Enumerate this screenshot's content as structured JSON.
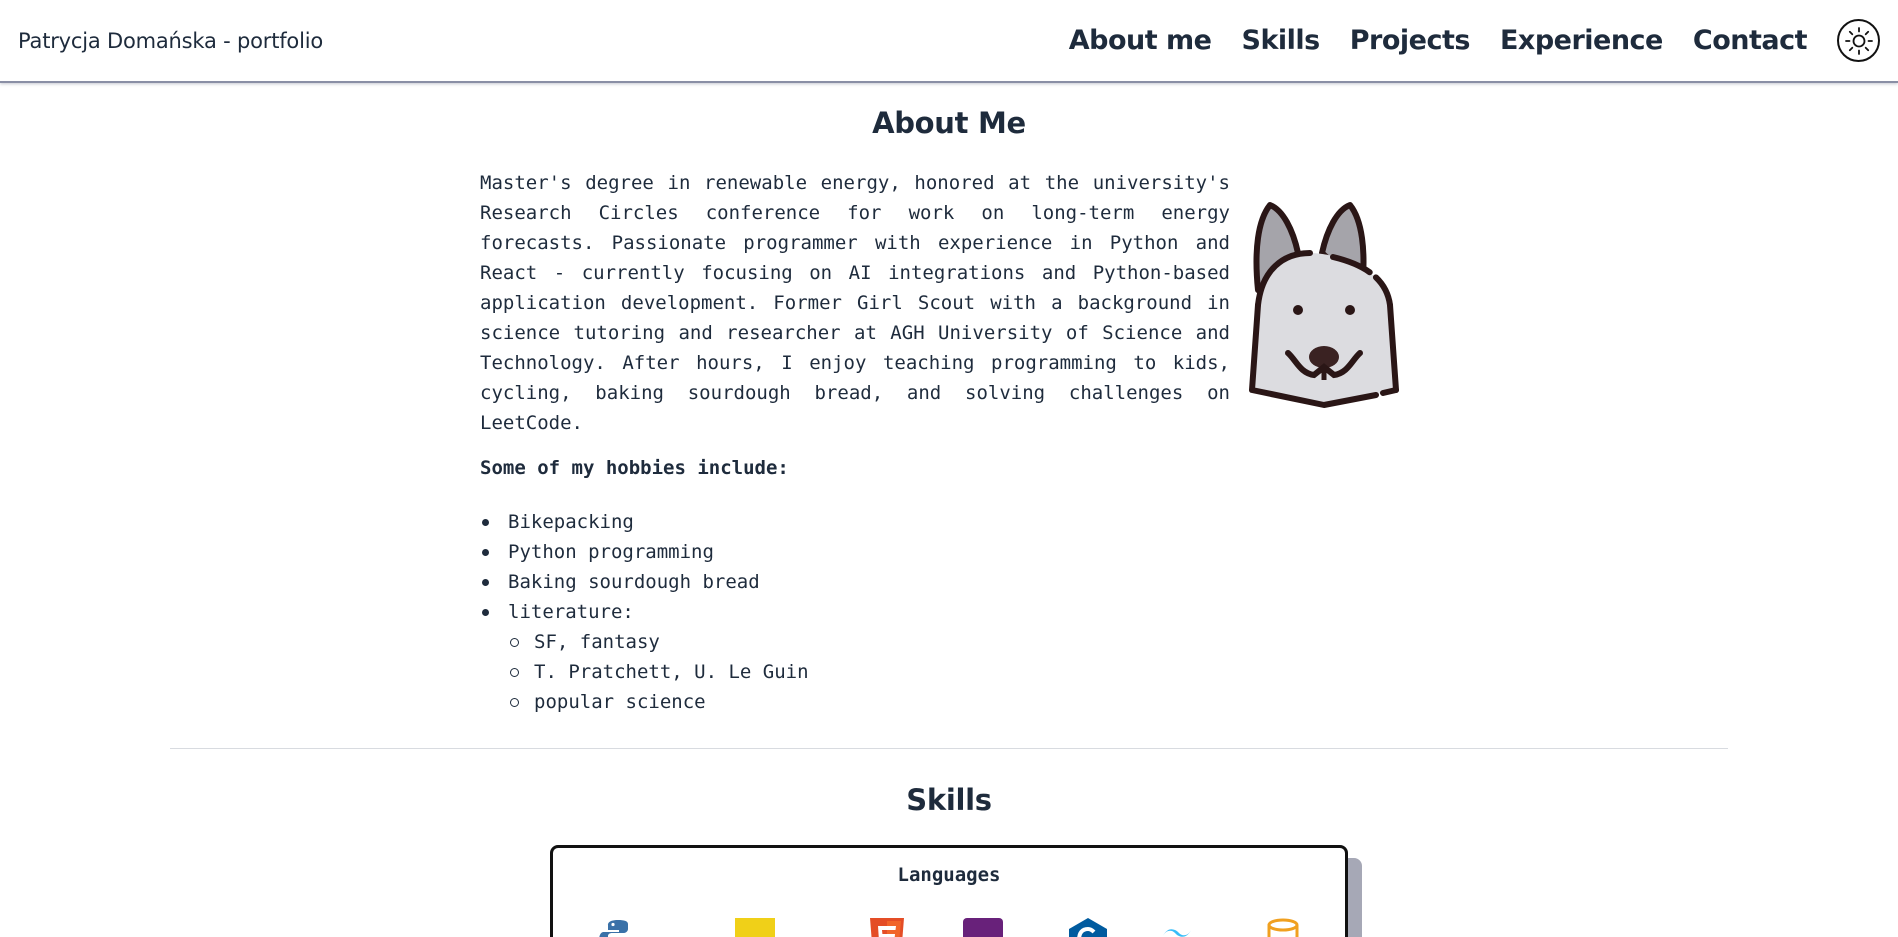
{
  "header": {
    "brand": "Patrycja Domańska - portfolio",
    "nav": [
      "About me",
      "Skills",
      "Projects",
      "Experience",
      "Contact"
    ],
    "theme_toggle_icon": "sun-icon"
  },
  "about": {
    "title": "About Me",
    "text": "Master's degree in renewable energy, honored at the university's Research Circles conference for work on long-term energy forecasts. Passionate programmer with experience in Python and React - currently focusing on AI integrations and Python-based application development. Former Girl Scout with a background in science tutoring and researcher at AGH University of Science and Technology. After hours, I enjoy teaching programming to kids, cycling, baking sourdough bread, and solving challenges on LeetCode.",
    "hobbies_heading": "Some of my hobbies include:",
    "hobbies": [
      "Bikepacking",
      "Python programming",
      "Baking sourdough bread",
      "literature:"
    ],
    "literature": [
      "SF, fantasy",
      "T. Pratchett, U. Le Guin",
      "popular science"
    ],
    "avatar_icon": "dog-icon"
  },
  "skills": {
    "title": "Skills",
    "card_title": "Languages",
    "icons": [
      "python-icon",
      "javascript-icon",
      "html5-icon",
      "csharp-icon",
      "c-icon",
      "tailwind-icon",
      "database-icon"
    ]
  },
  "colors": {
    "text": "#1e2b3c",
    "nav_border": "#8a8fa5",
    "card_shadow": "#a6a8b6"
  }
}
